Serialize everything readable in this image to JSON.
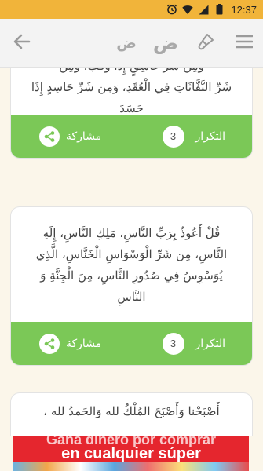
{
  "status_bar": {
    "time": "12:37",
    "icons": [
      "alarm-icon",
      "wifi-icon",
      "signal-icon",
      "battery-icon"
    ]
  },
  "app_bar": {
    "icons": [
      "back-arrow-icon",
      "brush-icon",
      "menu-icon"
    ],
    "font_small_label": "ض",
    "font_large_label": "ض"
  },
  "cards": [
    {
      "lines": [
        "وَمِن شَرِّ غَاسِقٍ إِذَا وَقَبَ، وَمِن",
        "شَرِّ النَّفَّاثَاتِ فِي الْعُقَدِ، وَمِن شَرِّ حَاسِدٍ إِذَا",
        "حَسَدَ"
      ],
      "share_label": "مشاركة",
      "repeat_label": "التكرار",
      "repeat_count": "3"
    },
    {
      "lines": [
        "قُلْ أَعُوذُ بِرَبِّ النَّاسِ، مَلِكِ النَّاسِ، إِلَهِ",
        "النَّاسِ، مِن شَرِّ الْوَسْوَاسِ الْخَنَّاسِ، الَّذِي",
        "يُوَسْوِسُ فِي صُدُورِ النَّاسِ، مِنَ الْجِنَّةِ وَ",
        "النَّاسِ"
      ],
      "share_label": "مشاركة",
      "repeat_label": "التكرار",
      "repeat_count": "3"
    },
    {
      "lines": [
        "أَصْبَحْنا وَأَصْبَحَ المُلْكُ لله وَالحَمدُ لله ،"
      ]
    }
  ],
  "ad": {
    "line1": "Gana dinero por comprar",
    "line2": "en cualquier súper"
  },
  "colors": {
    "status_bar": "#f1b43a",
    "card_footer": "#7bc857",
    "background": "#fbf6ea",
    "ad": "#e5262e"
  }
}
